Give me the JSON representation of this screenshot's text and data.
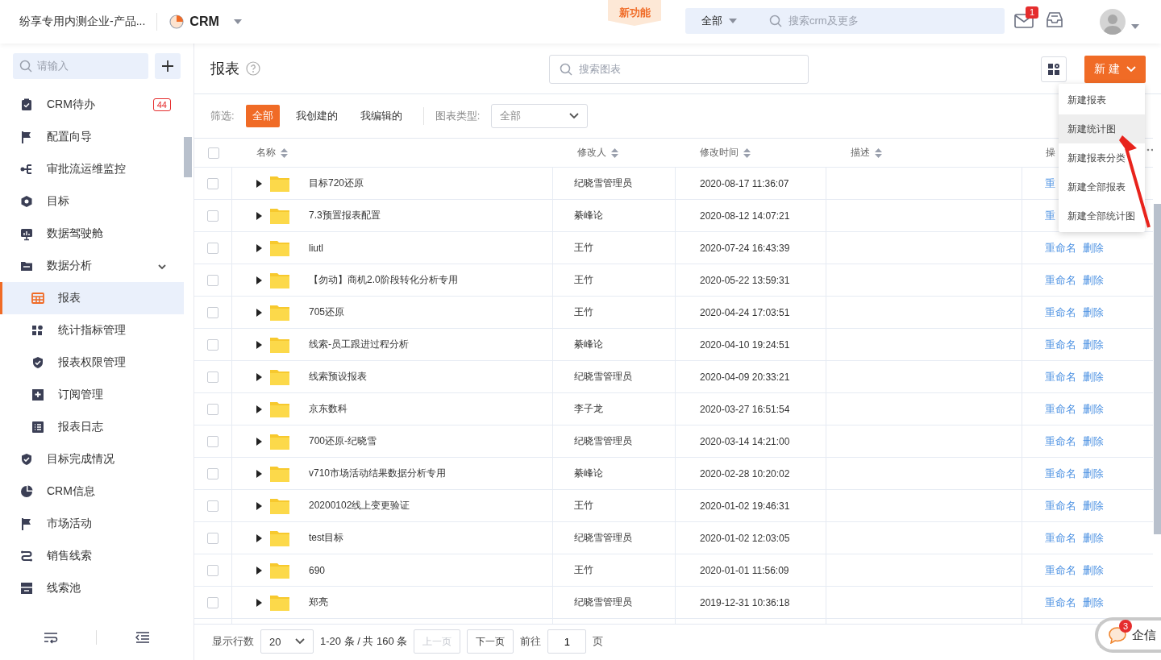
{
  "topbar": {
    "company": "纷享专用内测企业-产品...",
    "app_name": "CRM",
    "new_feature": "新功能",
    "search": {
      "scope": "全部",
      "placeholder": "搜索crm及更多"
    },
    "mail_badge": "1"
  },
  "sidebar": {
    "search_placeholder": "请输入",
    "items": [
      {
        "label": "CRM待办",
        "badge": "44",
        "selected": false
      },
      {
        "label": "配置向导",
        "selected": false
      },
      {
        "label": "审批流运维监控",
        "selected": false
      },
      {
        "label": "目标",
        "selected": false
      },
      {
        "label": "数据驾驶舱",
        "selected": false
      },
      {
        "label": "数据分析",
        "expanded": true,
        "selected": false,
        "children": [
          {
            "label": "报表",
            "selected": true
          },
          {
            "label": "统计指标管理",
            "selected": false
          },
          {
            "label": "报表权限管理",
            "selected": false
          },
          {
            "label": "订阅管理",
            "selected": false
          },
          {
            "label": "报表日志",
            "selected": false
          }
        ]
      },
      {
        "label": "目标完成情况",
        "selected": false
      },
      {
        "label": "CRM信息",
        "selected": false
      },
      {
        "label": "市场活动",
        "selected": false
      },
      {
        "label": "销售线索",
        "selected": false
      },
      {
        "label": "线索池",
        "selected": false
      }
    ]
  },
  "page": {
    "title": "报表",
    "search_placeholder": "搜索图表",
    "new_button": "新 建",
    "new_menu": [
      {
        "label": "新建报表",
        "selected": false
      },
      {
        "label": "新建统计图",
        "selected": true
      },
      {
        "label": "新建报表分类",
        "selected": false
      },
      {
        "label": "新建全部报表",
        "selected": false
      },
      {
        "label": "新建全部统计图",
        "selected": false
      }
    ]
  },
  "filter": {
    "label": "筛选:",
    "options": [
      {
        "label": "全部",
        "selected": true
      },
      {
        "label": "我创建的",
        "selected": false
      },
      {
        "label": "我编辑的",
        "selected": false
      }
    ],
    "type_label": "图表类型:",
    "type_value": "全部"
  },
  "table": {
    "select_all_checked": false,
    "columns": [
      "名称",
      "修改人",
      "修改时间",
      "描述",
      "操"
    ],
    "rows": [
      {
        "name": "目标720还原",
        "modifier": "纪晓雪管理员",
        "time": "2020-08-17 11:36:07",
        "checked": false,
        "actions": [
          "重"
        ]
      },
      {
        "name": "7.3预置报表配置",
        "modifier": "綦峰论",
        "time": "2020-08-12 14:07:21",
        "checked": false,
        "actions": [
          "重"
        ]
      },
      {
        "name": "liutl",
        "modifier": "王竹",
        "time": "2020-07-24 16:43:39",
        "checked": false,
        "actions": [
          "重命名",
          "删除"
        ]
      },
      {
        "name": "【勿动】商机2.0阶段转化分析专用",
        "modifier": "王竹",
        "time": "2020-05-22 13:59:31",
        "checked": false,
        "actions": [
          "重命名",
          "删除"
        ]
      },
      {
        "name": "705还原",
        "modifier": "王竹",
        "time": "2020-04-24 17:03:51",
        "checked": false,
        "actions": [
          "重命名",
          "删除"
        ]
      },
      {
        "name": "线索-员工跟进过程分析",
        "modifier": "綦峰论",
        "time": "2020-04-10 19:24:51",
        "checked": false,
        "actions": [
          "重命名",
          "删除"
        ]
      },
      {
        "name": "线索预设报表",
        "modifier": "纪晓雪管理员",
        "time": "2020-04-09 20:33:21",
        "checked": false,
        "actions": [
          "重命名",
          "删除"
        ]
      },
      {
        "name": "京东数科",
        "modifier": "李子龙",
        "time": "2020-03-27 16:51:54",
        "checked": false,
        "actions": [
          "重命名",
          "删除"
        ]
      },
      {
        "name": "700还原-纪晓雪",
        "modifier": "纪晓雪管理员",
        "time": "2020-03-14 14:21:00",
        "checked": false,
        "actions": [
          "重命名",
          "删除"
        ]
      },
      {
        "name": "v710市场活动结果数据分析专用",
        "modifier": "綦峰论",
        "time": "2020-02-28 10:20:02",
        "checked": false,
        "actions": [
          "重命名",
          "删除"
        ]
      },
      {
        "name": "20200102线上变更验证",
        "modifier": "王竹",
        "time": "2020-01-02 19:46:31",
        "checked": false,
        "actions": [
          "重命名",
          "删除"
        ]
      },
      {
        "name": "test目标",
        "modifier": "纪晓雪管理员",
        "time": "2020-01-02 12:03:05",
        "checked": false,
        "actions": [
          "重命名",
          "删除"
        ]
      },
      {
        "name": "690",
        "modifier": "王竹",
        "time": "2020-01-01 11:56:09",
        "checked": false,
        "actions": [
          "重命名",
          "删除"
        ]
      },
      {
        "name": "郑亮",
        "modifier": "纪晓雪管理员",
        "time": "2019-12-31 10:36:18",
        "checked": false,
        "actions": [
          "重命名",
          "删除"
        ]
      }
    ]
  },
  "pagination": {
    "rows_label": "显示行数",
    "rows_value": "20",
    "range": "1-20 条 / 共 160 条",
    "prev": "上一页",
    "prev_disabled": true,
    "next": "下一页",
    "next_disabled": false,
    "goto_label": "前往",
    "goto_value": "1",
    "page_suffix": "页"
  },
  "chat": {
    "label": "企信",
    "badge": "3"
  }
}
